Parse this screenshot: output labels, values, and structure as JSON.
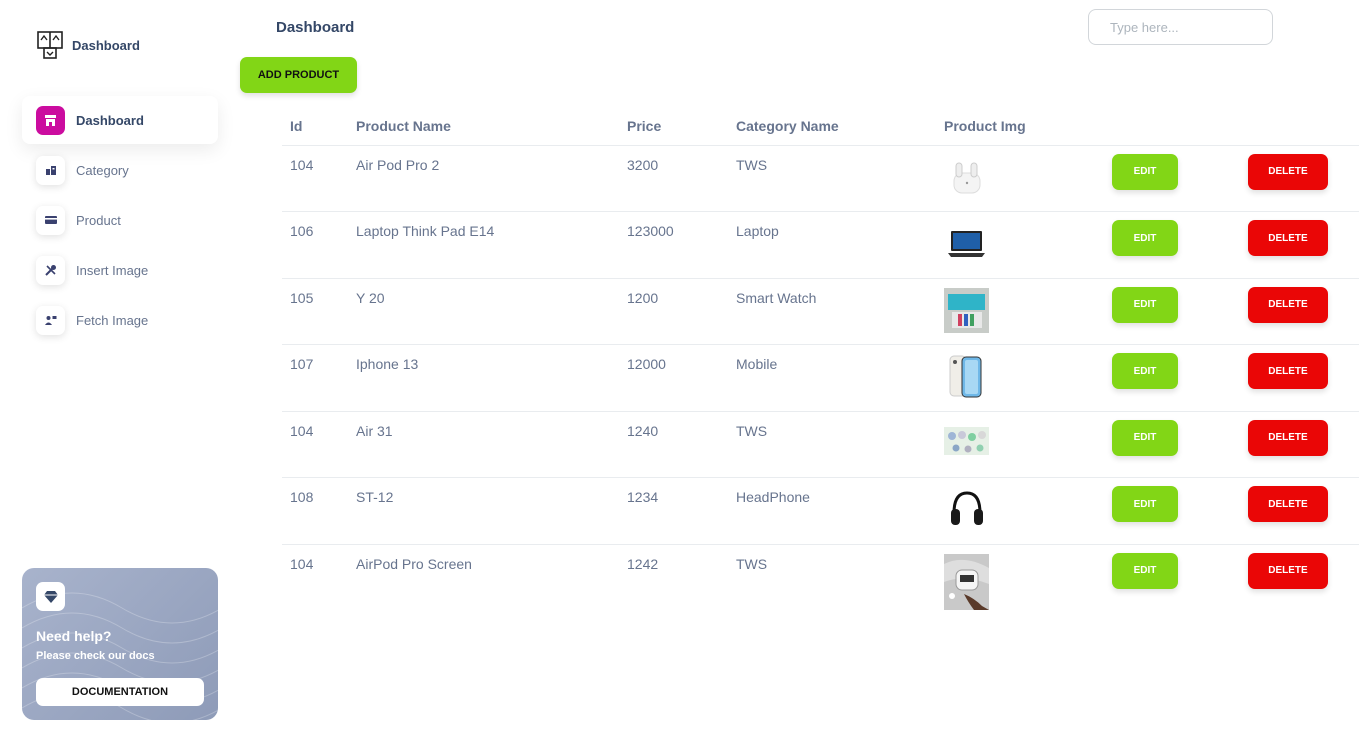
{
  "brand": {
    "name": "Dashboard"
  },
  "sidebar": {
    "items": [
      {
        "label": "Dashboard",
        "icon": "shop-icon",
        "active": true
      },
      {
        "label": "Category",
        "icon": "office-icon",
        "active": false
      },
      {
        "label": "Product",
        "icon": "credit-card-icon",
        "active": false
      },
      {
        "label": "Insert Image",
        "icon": "settings-tools-icon",
        "active": false
      },
      {
        "label": "Fetch Image",
        "icon": "user-icon",
        "active": false
      }
    ]
  },
  "help_card": {
    "title": "Need help?",
    "subtitle": "Please check our docs",
    "button_label": "DOCUMENTATION",
    "icon": "diamond-icon"
  },
  "header": {
    "title": "Dashboard",
    "search_placeholder": "Type here...",
    "add_button_label": "ADD PRODUCT"
  },
  "table": {
    "columns": [
      "Id",
      "Product Name",
      "Price",
      "Category Name",
      "Product Img"
    ],
    "edit_label": "EDIT",
    "delete_label": "DELETE",
    "rows": [
      {
        "id": "104",
        "name": "Air Pod Pro 2",
        "price": "3200",
        "category": "TWS",
        "image": "airpods-thumbnail"
      },
      {
        "id": "106",
        "name": "Laptop Think Pad E14",
        "price": "123000",
        "category": "Laptop",
        "image": "laptop-thumbnail"
      },
      {
        "id": "105",
        "name": "Y 20",
        "price": "1200",
        "category": "Smart Watch",
        "image": "smartwatch-box-thumbnail"
      },
      {
        "id": "107",
        "name": "Iphone 13",
        "price": "12000",
        "category": "Mobile",
        "image": "iphone-thumbnail"
      },
      {
        "id": "104",
        "name": "Air 31",
        "price": "1240",
        "category": "TWS",
        "image": "earbuds-set-thumbnail"
      },
      {
        "id": "108",
        "name": "ST-12",
        "price": "1234",
        "category": "HeadPhone",
        "image": "headphone-thumbnail"
      },
      {
        "id": "104",
        "name": "AirPod Pro Screen",
        "price": "1242",
        "category": "TWS",
        "image": "airpod-screen-thumbnail"
      }
    ]
  },
  "colors": {
    "accent_green": "#82d616",
    "danger_red": "#ea0606",
    "active_nav": "#cb0c9f",
    "text": "#344767",
    "muted": "#67748e"
  }
}
